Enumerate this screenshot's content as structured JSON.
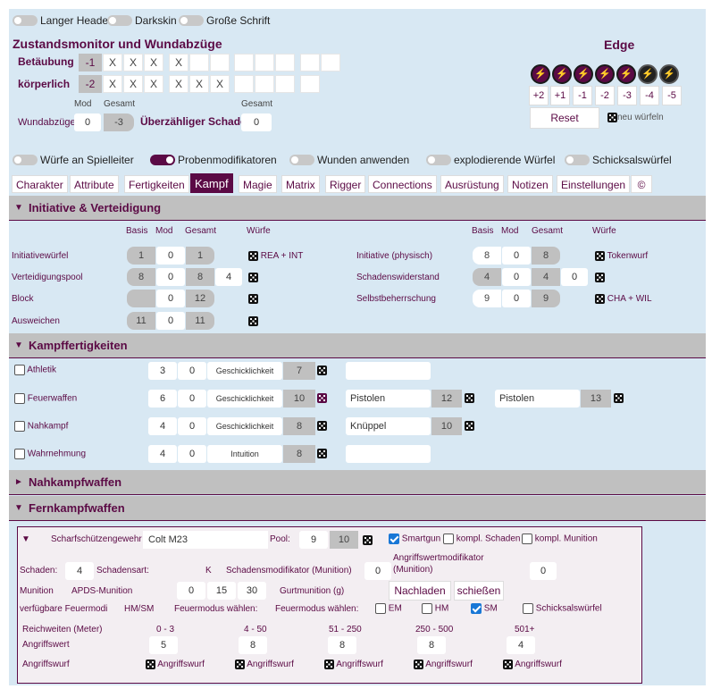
{
  "toggles_top": [
    "Langer Header",
    "Darkskin",
    "Große Schrift"
  ],
  "zustand": {
    "title": "Zustandsmonitor und Wundabzüge",
    "betaeubung": "Betäubung",
    "koerperlich": "körperlich",
    "bet_mod": "-1",
    "koe_mod": "-2",
    "x": "X",
    "mod": "Mod",
    "gesamt": "Gesamt",
    "wundabzuege": "Wundabzüge",
    "wund_mod": "0",
    "wund_ges": "-3",
    "ueberzaehlig": "Überzähliger Schaden",
    "ueber_gesamt_label": "Gesamt",
    "ueber_val": "0"
  },
  "edge": {
    "title": "Edge",
    "buttons": [
      "+2",
      "+1",
      "-1",
      "-2",
      "-3",
      "-4",
      "-5"
    ],
    "reset": "Reset",
    "neu": "neu würfeln",
    "icon": "lightning-icon"
  },
  "toggles_mid": [
    "Würfe an Spielleiter",
    "Probenmodifikatoren",
    "Wunden anwenden",
    "explodierende Würfel",
    "Schicksalswürfel"
  ],
  "tabs": [
    "Charakter",
    "Attribute",
    "Fertigkeiten",
    "Kampf",
    "Magie",
    "Matrix",
    "Rigger",
    "Connections",
    "Ausrüstung",
    "Notizen",
    "Einstellungen",
    "©"
  ],
  "init": {
    "title": "Initiative & Verteidigung",
    "h_basis": "Basis",
    "h_mod": "Mod",
    "h_gesamt": "Gesamt",
    "h_wuerfe": "Würfe",
    "rows": [
      {
        "label": "Initiativewürfel",
        "basis": "1",
        "mod": "0",
        "gesamt": "1",
        "extra": "",
        "wurf": "REA + INT"
      },
      {
        "label": "Verteidigungspool",
        "basis": "8",
        "mod": "0",
        "gesamt": "8",
        "extra": "4",
        "wurf": ""
      },
      {
        "label": "Block",
        "basis": "",
        "mod": "0",
        "gesamt": "12",
        "extra": "",
        "wurf": ""
      },
      {
        "label": "Ausweichen",
        "basis": "11",
        "mod": "0",
        "gesamt": "11",
        "extra": "",
        "wurf": ""
      }
    ],
    "rrows": [
      {
        "label": "Initiative (physisch)",
        "basis": "8",
        "mod": "0",
        "gesamt": "8",
        "extra": "",
        "wurf": "Tokenwurf"
      },
      {
        "label": "Schadenswiderstand",
        "basis": "4",
        "mod": "0",
        "gesamt": "4",
        "extra": "0",
        "wurf": ""
      },
      {
        "label": "Selbstbeherrschung",
        "basis": "9",
        "mod": "0",
        "gesamt": "9",
        "extra": "",
        "wurf": "CHA + WIL"
      }
    ]
  },
  "kampf": {
    "title": "Kampffertigkeiten",
    "rows": [
      {
        "label": "Athletik",
        "basis": "3",
        "mod": "0",
        "attr": "Geschicklichkeit",
        "total": "7",
        "s1": "",
        "s1v": "",
        "s2": "",
        "s2v": ""
      },
      {
        "label": "Feuerwaffen",
        "basis": "6",
        "mod": "0",
        "attr": "Geschicklichkeit",
        "total": "10",
        "s1": "Pistolen",
        "s1v": "12",
        "s2": "Pistolen",
        "s2v": "13"
      },
      {
        "label": "Nahkampf",
        "basis": "4",
        "mod": "0",
        "attr": "Geschicklichkeit",
        "total": "8",
        "s1": "Knüppel",
        "s1v": "10",
        "s2": "",
        "s2v": ""
      },
      {
        "label": "Wahrnehmung",
        "basis": "4",
        "mod": "0",
        "attr": "Intuition",
        "total": "8",
        "s1": "",
        "s1v": "",
        "s2": "",
        "s2v": ""
      }
    ]
  },
  "nahkampf": {
    "title": "Nahkampfwaffen"
  },
  "fern": {
    "title": "Fernkampfwaffen",
    "type": "Scharfschützengewehr",
    "name": "Colt M23",
    "pool_label": "Pool:",
    "pool": "9",
    "pool_total": "10",
    "smartgun": "Smartgun",
    "kompl_schaden": "kompl. Schaden",
    "kompl_munition": "kompl. Munition",
    "schaden_label": "Schaden:",
    "schaden": "4",
    "schadensart_label": "Schadensart:",
    "schadensart": "K",
    "schadensmod_label": "Schadensmodifikator (Munition)",
    "schadensmod": "0",
    "angriffsmod_label": "Angriffswertmodifikator (Munition)",
    "angriffsmod": "0",
    "munition_label": "Munition",
    "munition": "APDS-Munition",
    "mun1": "0",
    "mun2": "15",
    "mun3": "30",
    "gurt": "Gurtmunition (g)",
    "nachladen": "Nachladen",
    "schiessen": "schießen",
    "feuermodi_label": "verfügbare Feuermodi",
    "feuermodi": "HM/SM",
    "fm_waehlen": "Feuermodus wählen:",
    "fm_waehlen2": "Feuermodus wählen:",
    "em": "EM",
    "hm": "HM",
    "sm": "SM",
    "schicksal": "Schicksalswürfel",
    "reichweiten_label": "Reichweiten (Meter)",
    "reichweiten": [
      "0 - 3",
      "4 - 50",
      "51 - 250",
      "250 - 500",
      "501+"
    ],
    "angriffswert_label": "Angriffswert",
    "angriffswerte": [
      "5",
      "8",
      "8",
      "8",
      "4"
    ],
    "angriffswurf_label": "Angriffswurf",
    "angriffswurf": "Angriffswurf"
  }
}
